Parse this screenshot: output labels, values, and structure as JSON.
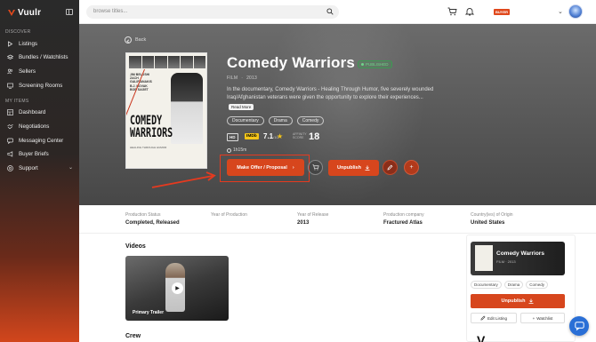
{
  "brand": {
    "name": "Vuulr"
  },
  "sidebar": {
    "sections": [
      {
        "label": "DISCOVER"
      },
      {
        "label": "MY ITEMS"
      }
    ],
    "discover_items": [
      {
        "label": "Listings",
        "icon": "play-icon"
      },
      {
        "label": "Bundles / Watchlists",
        "icon": "layers-icon"
      },
      {
        "label": "Sellers",
        "icon": "users-icon"
      },
      {
        "label": "Screening Rooms",
        "icon": "monitor-icon"
      }
    ],
    "my_items": [
      {
        "label": "Dashboard",
        "icon": "dashboard-icon"
      },
      {
        "label": "Negotiations",
        "icon": "handshake-icon"
      },
      {
        "label": "Messaging Center",
        "icon": "chat-icon"
      },
      {
        "label": "Buyer Briefs",
        "icon": "megaphone-icon"
      },
      {
        "label": "Support",
        "icon": "help-icon"
      }
    ]
  },
  "topbar": {
    "search_placeholder": "browse titles...",
    "buyer_badge": "BUYER"
  },
  "hero": {
    "back_label": "Back",
    "title": "Comedy Warriors",
    "status": "PUBLISHED",
    "type": "FILM",
    "year": "2013",
    "description": "In the documentary, Comedy Warriors - Healing Through Humor, five severely wounded Iraq/Afghanistan veterans were given the opportunity to explore their experiences...",
    "read_more": "Read More",
    "genres": [
      "Documentary",
      "Drama",
      "Comedy"
    ],
    "hd": "HD",
    "imdb": "IMDb",
    "imdb_rating": "7.1",
    "imdb_scale": "/10",
    "affinity_label": "AFFINITY SCORE",
    "affinity_score": "18",
    "runtime": "1h15m",
    "poster": {
      "names": "JIM BELUSHI\nZACH GALIFIANAKIS\nB.J. NOVAK\nBOB SAGET",
      "title": "COMEDY\nWARRIORS",
      "tagline": "HEALING THROUGH HUMOR"
    },
    "make_offer_label": "Make Offer / Proposal",
    "unpublish_label": "Unpublish"
  },
  "info": [
    {
      "label": "Production Status",
      "value": "Completed, Released"
    },
    {
      "label": "Year of Production",
      "value": ""
    },
    {
      "label": "Year of Release",
      "value": "2013"
    },
    {
      "label": "Production company",
      "value": "Fractured Atlas"
    },
    {
      "label": "Country(ies) of Origin",
      "value": "United States"
    }
  ],
  "videos": {
    "title": "Videos",
    "items": [
      {
        "label": "Primary Trailer"
      }
    ]
  },
  "crew": {
    "title": "Crew"
  },
  "side_panel": {
    "title": "Comedy Warriors",
    "meta": "FILM · 2013",
    "genres": [
      "Documentary",
      "Drama",
      "Comedy"
    ],
    "unpublish_label": "Unpublish",
    "edit_label": "Edit Listing",
    "watchlist_label": "Watchlist",
    "partial_letter": "V"
  },
  "colors": {
    "accent": "#d7461d",
    "published": "#3c9a52",
    "imdb": "#f5c518",
    "chat": "#2a6fd6"
  }
}
